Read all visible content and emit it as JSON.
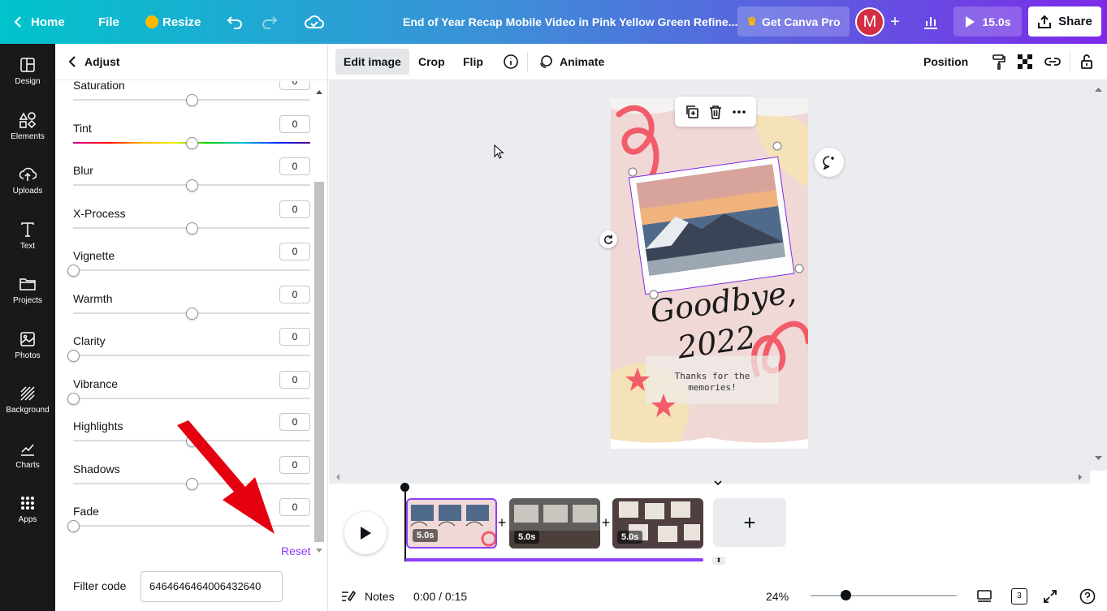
{
  "topbar": {
    "home": "Home",
    "file": "File",
    "resize": "Resize",
    "title": "End of Year Recap Mobile Video in Pink Yellow Green Refine...",
    "get_pro": "Get Canva Pro",
    "avatar_letter": "M",
    "duration": "15.0s",
    "share": "Share"
  },
  "sidebar": {
    "items": [
      {
        "label": "Design",
        "icon": "design-icon"
      },
      {
        "label": "Elements",
        "icon": "elements-icon"
      },
      {
        "label": "Uploads",
        "icon": "upload-icon"
      },
      {
        "label": "Text",
        "icon": "text-icon"
      },
      {
        "label": "Projects",
        "icon": "folder-icon"
      },
      {
        "label": "Photos",
        "icon": "photo-icon"
      },
      {
        "label": "Background",
        "icon": "background-icon"
      },
      {
        "label": "Charts",
        "icon": "chart-icon"
      },
      {
        "label": "Apps",
        "icon": "apps-icon"
      }
    ]
  },
  "adjust": {
    "title": "Adjust",
    "sliders": [
      {
        "label": "Saturation",
        "value": "0",
        "position": 0.5
      },
      {
        "label": "Tint",
        "value": "0",
        "position": 0.5
      },
      {
        "label": "Blur",
        "value": "0",
        "position": 0.5
      },
      {
        "label": "X-Process",
        "value": "0",
        "position": 0.5
      },
      {
        "label": "Vignette",
        "value": "0",
        "position": 0.0
      },
      {
        "label": "Warmth",
        "value": "0",
        "position": 0.5
      },
      {
        "label": "Clarity",
        "value": "0",
        "position": 0.0
      },
      {
        "label": "Vibrance",
        "value": "0",
        "position": 0.0
      },
      {
        "label": "Highlights",
        "value": "0",
        "position": 0.5
      },
      {
        "label": "Shadows",
        "value": "0",
        "position": 0.5
      },
      {
        "label": "Fade",
        "value": "0",
        "position": 0.0
      }
    ],
    "reset": "Reset",
    "filter_code_label": "Filter code",
    "filter_code_value": "6464646464006432640"
  },
  "context_toolbar": {
    "edit_image": "Edit image",
    "crop": "Crop",
    "flip": "Flip",
    "animate": "Animate",
    "position": "Position"
  },
  "design": {
    "heading_line1": "Goodbye,",
    "heading_line2": "2022",
    "note_line1": "Thanks for the",
    "note_line2": "memories!"
  },
  "timeline": {
    "clips": [
      {
        "duration": "5.0s"
      },
      {
        "duration": "5.0s"
      },
      {
        "duration": "5.0s"
      }
    ],
    "add": "+"
  },
  "footer": {
    "notes": "Notes",
    "time": "0:00 / 0:15",
    "zoom": "24%",
    "zoom_level": 0.24,
    "pages": "3"
  },
  "colors": {
    "accent": "#8b3dff",
    "annotation_arrow": "#e5000f",
    "sidebar_bg": "#18191b"
  }
}
